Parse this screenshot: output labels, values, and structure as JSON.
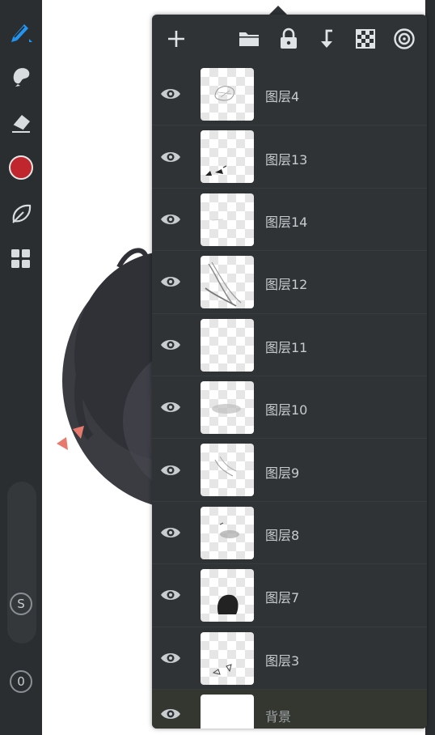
{
  "toolbar": {
    "tools": [
      {
        "name": "brush-icon",
        "accent": "#2196f3"
      },
      {
        "name": "smudge-icon"
      },
      {
        "name": "eraser-icon"
      },
      {
        "name": "color-swatch",
        "color": "#c0262d"
      },
      {
        "name": "leaf-icon"
      },
      {
        "name": "grid-icon"
      }
    ],
    "size_button_label": "S",
    "opacity_button_label": "0"
  },
  "layers_panel": {
    "toolbar_icons": [
      "add-icon",
      "folder-icon",
      "lock-icon",
      "merge-down-icon",
      "transparency-icon",
      "target-icon"
    ],
    "layers": [
      {
        "name": "图层4",
        "visible": true
      },
      {
        "name": "图层13",
        "visible": true
      },
      {
        "name": "图层14",
        "visible": true
      },
      {
        "name": "图层12",
        "visible": true
      },
      {
        "name": "图层11",
        "visible": true
      },
      {
        "name": "图层10",
        "visible": true
      },
      {
        "name": "图层9",
        "visible": true
      },
      {
        "name": "图层8",
        "visible": true
      },
      {
        "name": "图层7",
        "visible": true
      },
      {
        "name": "图层3",
        "visible": true
      }
    ],
    "background_layer": {
      "name": "背景",
      "visible": true
    }
  },
  "colors": {
    "panel_bg": "#2f3336",
    "toolbar_bg": "#2b2e31",
    "accent": "#2196f3",
    "current_color": "#c0262d"
  }
}
